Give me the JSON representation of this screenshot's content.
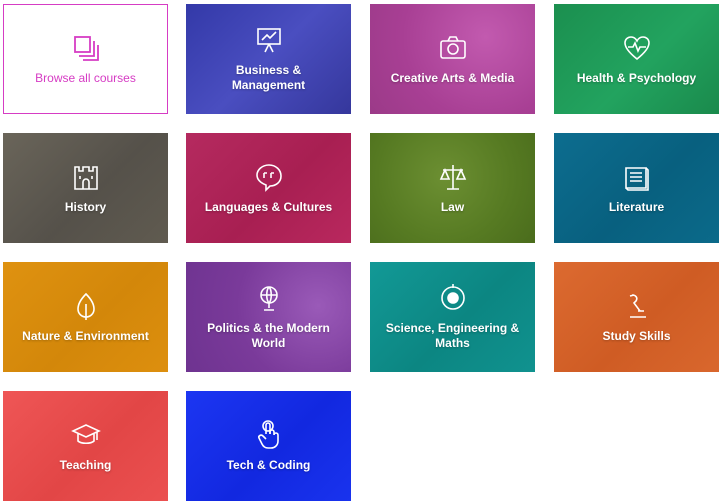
{
  "tiles": {
    "browse": {
      "label": "Browse all courses",
      "icon": "stacked-pages-icon",
      "color": "#d63cc4"
    },
    "business": {
      "label": "Business & Management",
      "icon": "presentation-board-icon",
      "color": "#3b3fb0"
    },
    "creative": {
      "label": "Creative Arts & Media",
      "icon": "camera-icon",
      "color": "#b0479c"
    },
    "health": {
      "label": "Health & Psychology",
      "icon": "heart-pulse-icon",
      "color": "#1f9a57"
    },
    "history": {
      "label": "History",
      "icon": "castle-icon",
      "color": "#5f5a4f"
    },
    "languages": {
      "label": "Languages & Cultures",
      "icon": "speech-bubble-icon",
      "color": "#b3245a"
    },
    "law": {
      "label": "Law",
      "icon": "scales-icon",
      "color": "#5a7d24"
    },
    "literature": {
      "label": "Literature",
      "icon": "open-book-icon",
      "color": "#0b6a8a"
    },
    "nature": {
      "label": "Nature & Environment",
      "icon": "leaf-icon",
      "color": "#d98a06"
    },
    "politics": {
      "label": "Politics & the Modern World",
      "icon": "globe-icon",
      "color": "#7a3a9a"
    },
    "science": {
      "label": "Science, Engineering & Maths",
      "icon": "atom-icon",
      "color": "#0e8e8a"
    },
    "study": {
      "label": "Study Skills",
      "icon": "desk-lamp-icon",
      "color": "#d4622c"
    },
    "teaching": {
      "label": "Teaching",
      "icon": "graduation-cap-icon",
      "color": "#e84d4d"
    },
    "tech": {
      "label": "Tech & Coding",
      "icon": "pointer-hand-icon",
      "color": "#1630ee"
    }
  }
}
